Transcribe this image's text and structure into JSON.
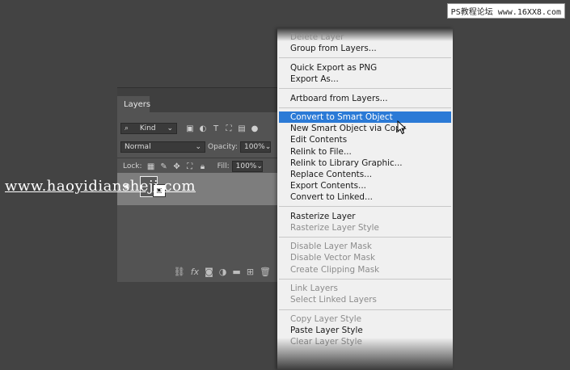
{
  "watermarks": {
    "top_right": "PS教程论坛 www.16XX8.com",
    "center_left": "www.haoyidiansheji.com"
  },
  "layers_panel": {
    "collapse_glyph": "‹‹",
    "tab_label": "Layers",
    "filter_kind": "Kind",
    "blend_mode": "Normal",
    "opacity_label": "Opacity:",
    "opacity_value": "100%",
    "lock_label": "Lock:",
    "fill_label": "Fill:",
    "fill_value": "100%",
    "layer_badge": "▣"
  },
  "context_menu": {
    "groups": [
      [
        {
          "label": "Delete Layer",
          "disabled": true
        },
        {
          "label": "Group from Layers...",
          "disabled": false
        }
      ],
      [
        {
          "label": "Quick Export as PNG",
          "disabled": false
        },
        {
          "label": "Export As...",
          "disabled": false
        }
      ],
      [
        {
          "label": "Artboard from Layers...",
          "disabled": false
        }
      ],
      [
        {
          "label": "Convert to Smart Object",
          "disabled": false,
          "selected": true
        },
        {
          "label": "New Smart Object via Copy",
          "disabled": false
        },
        {
          "label": "Edit Contents",
          "disabled": false
        },
        {
          "label": "Relink to File...",
          "disabled": false
        },
        {
          "label": "Relink to Library Graphic...",
          "disabled": false
        },
        {
          "label": "Replace Contents...",
          "disabled": false
        },
        {
          "label": "Export Contents...",
          "disabled": false
        },
        {
          "label": "Convert to Linked...",
          "disabled": false
        }
      ],
      [
        {
          "label": "Rasterize Layer",
          "disabled": false
        },
        {
          "label": "Rasterize Layer Style",
          "disabled": true
        }
      ],
      [
        {
          "label": "Disable Layer Mask",
          "disabled": true
        },
        {
          "label": "Disable Vector Mask",
          "disabled": true
        },
        {
          "label": "Create Clipping Mask",
          "disabled": true
        }
      ],
      [
        {
          "label": "Link Layers",
          "disabled": true
        },
        {
          "label": "Select Linked Layers",
          "disabled": true
        }
      ],
      [
        {
          "label": "Copy Layer Style",
          "disabled": true
        },
        {
          "label": "Paste Layer Style",
          "disabled": false
        },
        {
          "label": "Clear Layer Style",
          "disabled": true
        }
      ]
    ]
  },
  "colors": {
    "background": "#434343",
    "menu_bg": "#f0f0f0",
    "highlight": "#2b7ad6"
  }
}
